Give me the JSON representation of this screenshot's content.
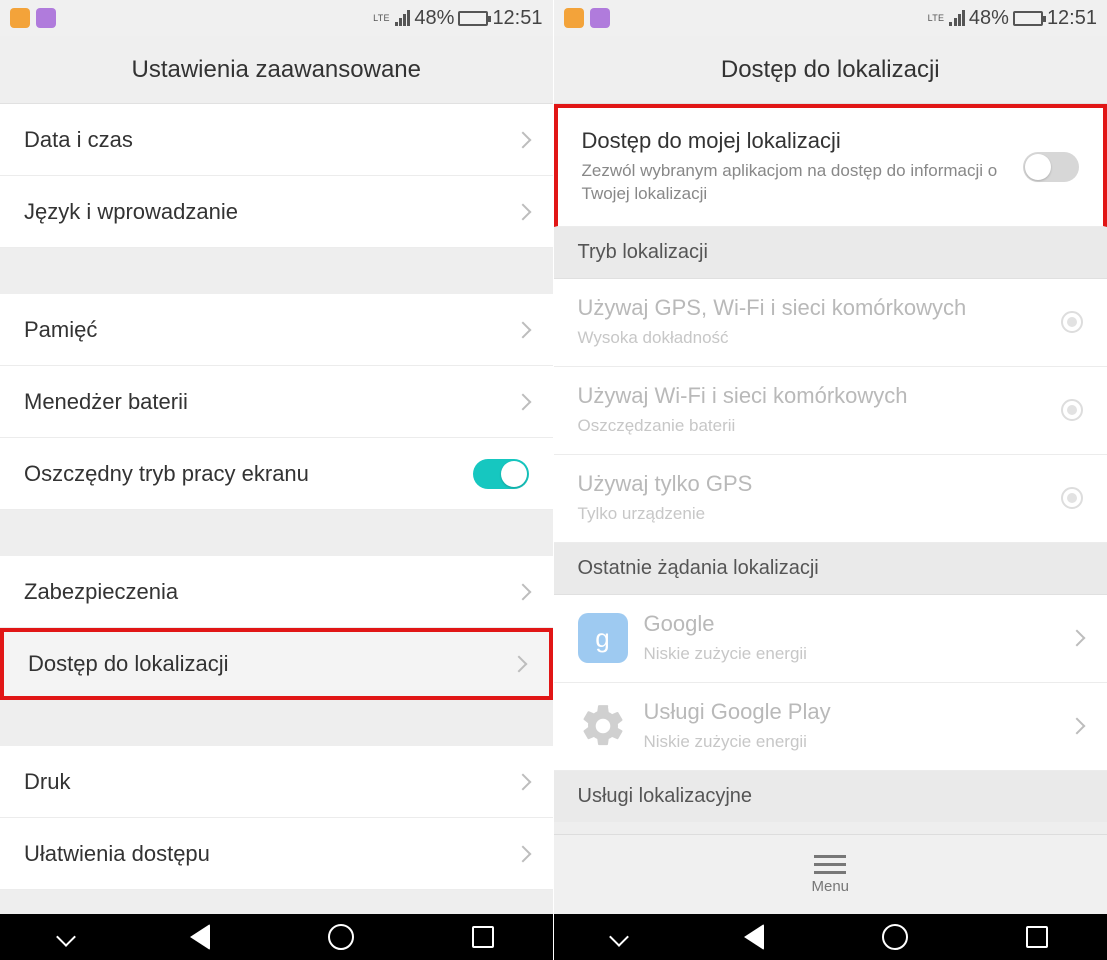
{
  "statusbar": {
    "battery_pct": "48%",
    "time": "12:51",
    "net_label": "LTE"
  },
  "left": {
    "title": "Ustawienia zaawansowane",
    "rows1": [
      {
        "label": "Data i czas"
      },
      {
        "label": "Język i wprowadzanie"
      }
    ],
    "rows2": [
      {
        "label": "Pamięć"
      },
      {
        "label": "Menedżer baterii"
      }
    ],
    "eco_label": "Oszczędny tryb pracy ekranu",
    "rows3": [
      {
        "label": "Zabezpieczenia"
      },
      {
        "label": "Dostęp do lokalizacji"
      }
    ],
    "rows4": [
      {
        "label": "Druk"
      },
      {
        "label": "Ułatwienia dostępu"
      }
    ]
  },
  "right": {
    "title": "Dostęp do lokalizacji",
    "access_title": "Dostęp do mojej lokalizacji",
    "access_sub": "Zezwól wybranym aplikacjom na dostęp do informacji o Twojej lokalizacji",
    "mode_header": "Tryb lokalizacji",
    "modes": [
      {
        "title": "Używaj GPS, Wi-Fi i sieci komórkowych",
        "sub": "Wysoka dokładność"
      },
      {
        "title": "Używaj Wi-Fi i sieci komórkowych",
        "sub": "Oszczędzanie baterii"
      },
      {
        "title": "Używaj tylko GPS",
        "sub": "Tylko urządzenie"
      }
    ],
    "recent_header": "Ostatnie żądania lokalizacji",
    "apps": [
      {
        "title": "Google",
        "sub": "Niskie zużycie energii",
        "glyph": "g"
      },
      {
        "title": "Usługi Google Play",
        "sub": "Niskie zużycie energii",
        "glyph": "⚙"
      }
    ],
    "services_header": "Usługi lokalizacyjne",
    "menu_label": "Menu"
  }
}
